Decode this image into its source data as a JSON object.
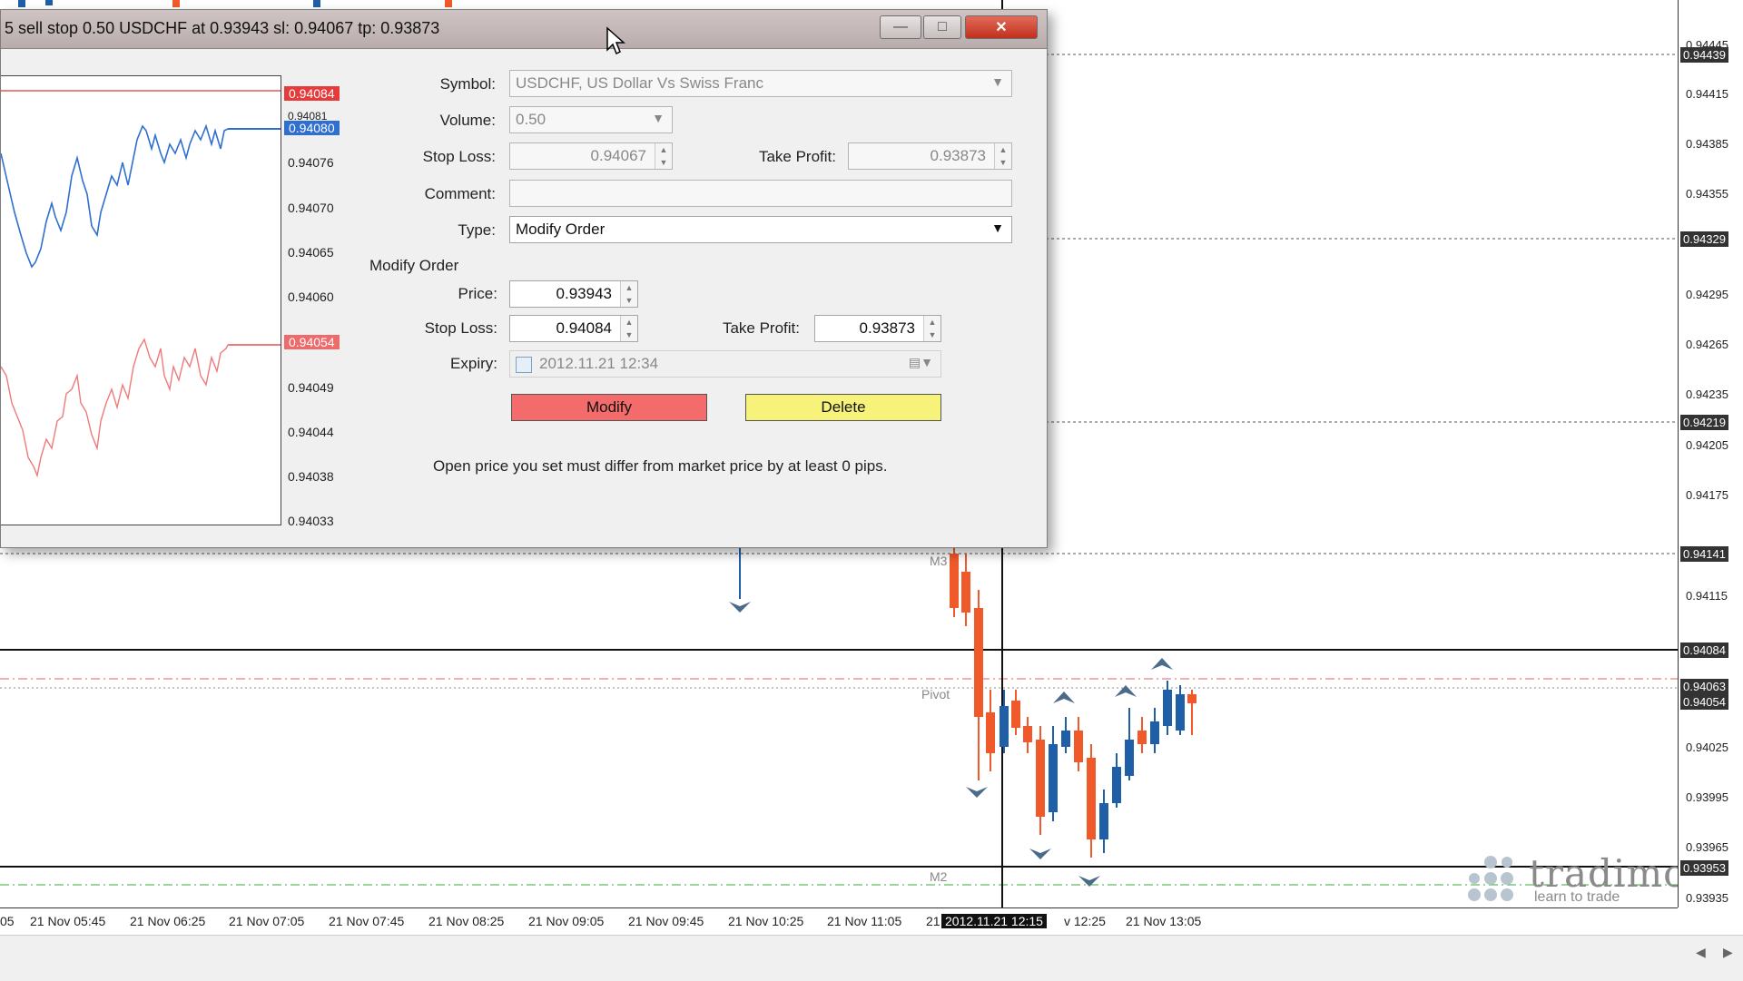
{
  "dialog": {
    "title": "5 sell stop 0.50 USDCHF at 0.93943 sl: 0.94067 tp: 0.93873",
    "symbol": {
      "label": "Symbol:",
      "value": "USDCHF, US Dollar Vs Swiss Franc"
    },
    "volume": {
      "label": "Volume:",
      "value": "0.50"
    },
    "stop_loss_top": {
      "label": "Stop Loss:",
      "value": "0.94067"
    },
    "take_profit_top": {
      "label": "Take Profit:",
      "value": "0.93873"
    },
    "comment": {
      "label": "Comment:",
      "value": ""
    },
    "type": {
      "label": "Type:",
      "value": "Modify Order"
    },
    "modify_group": {
      "title": "Modify Order",
      "price": {
        "label": "Price:",
        "value": "0.93943"
      },
      "stop_loss": {
        "label": "Stop Loss:",
        "value": "0.94084"
      },
      "take_profit": {
        "label": "Take Profit:",
        "value": "0.93873"
      },
      "expiry": {
        "label": "Expiry:",
        "value": "2012.11.21 12:34"
      }
    },
    "buttons": {
      "modify": "Modify",
      "delete": "Delete"
    },
    "note": "Open price you set must differ from market price by at least 0 pips.",
    "mini_chart": {
      "axis_labels": [
        "0.94084",
        "0.94081",
        "0.94080",
        "0.94076",
        "0.94070",
        "0.94065",
        "0.94060",
        "0.94054",
        "0.94049",
        "0.94044",
        "0.94038",
        "0.94033"
      ],
      "ask_label": "0.94084",
      "bid_label": "0.94080",
      "sell_label": "0.94054"
    }
  },
  "colors": {
    "modify_button": "#f36b6b",
    "delete_button": "#f7f37a",
    "ask_line": "#2f6fd1",
    "bid_line": "#ef7a7a",
    "bull_candle": "#1f5fa8",
    "bear_candle": "#f05a2a"
  },
  "chart": {
    "price_ticks": [
      "0.94445",
      "0.94415",
      "0.94385",
      "0.94355",
      "0.94295",
      "0.94265",
      "0.94235",
      "0.94205",
      "0.94175",
      "0.94115",
      "0.94025",
      "0.93995",
      "0.93965",
      "0.93935"
    ],
    "price_highlights": [
      "0.94439",
      "0.94329",
      "0.94219",
      "0.94141",
      "0.94084",
      "0.94063",
      "0.94054",
      "0.93953"
    ],
    "time_labels": [
      "05",
      "21 Nov 05:45",
      "21 Nov 06:25",
      "21 Nov 07:05",
      "21 Nov 07:45",
      "21 Nov 08:25",
      "21 Nov 09:05",
      "21 Nov 09:45",
      "21 Nov 10:25",
      "21 Nov 11:05",
      "21",
      "v 12:25",
      "21 Nov 13:05"
    ],
    "current_time": "2012.11.21 12:15",
    "labels": {
      "m3": "M3",
      "pivot": "Pivot",
      "m2": "M2"
    }
  },
  "watermark": {
    "brand": "tradimo",
    "tagline": "learn to trade"
  }
}
